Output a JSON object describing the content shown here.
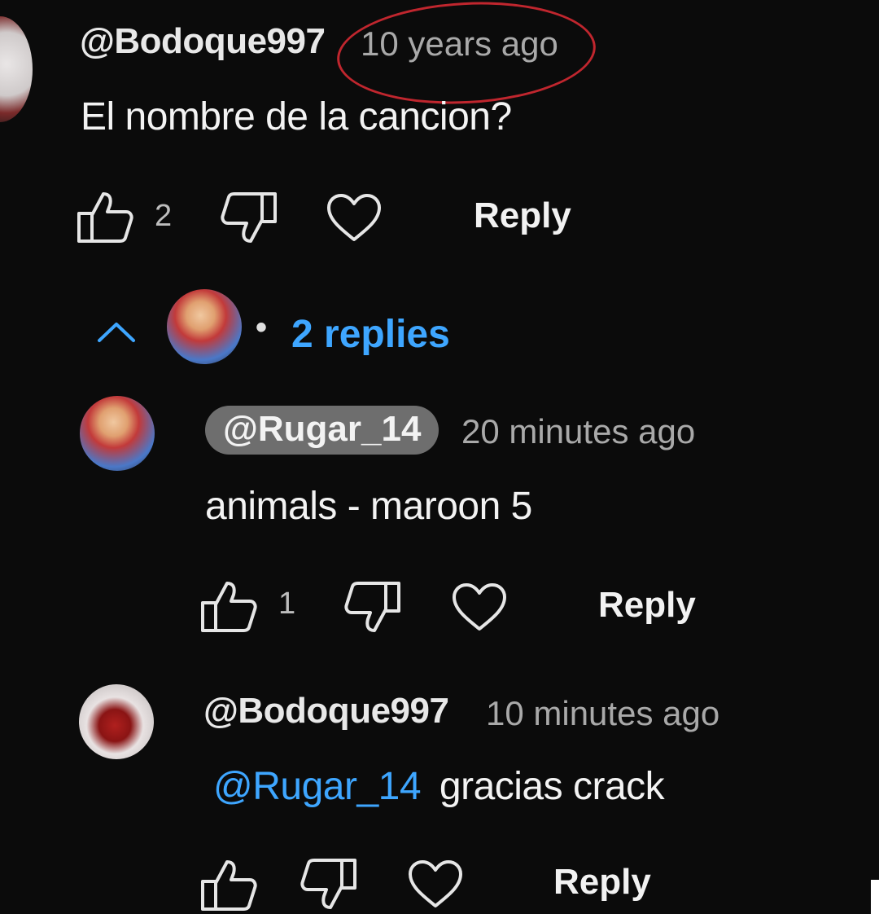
{
  "comment": {
    "author": "@Bodoque997",
    "time": "10 years ago",
    "text": "El nombre de la cancion?",
    "likes": "2",
    "reply_label": "Reply"
  },
  "replies_toggle": {
    "bullet": "•",
    "label": "2 replies"
  },
  "replies": [
    {
      "author": "@Rugar_14",
      "time": "20 minutes ago",
      "text": "animals - maroon 5",
      "likes": "1",
      "reply_label": "Reply"
    },
    {
      "author": "@Bodoque997",
      "time": "10 minutes ago",
      "mention": "@Rugar_14",
      "text": "gracias crack",
      "likes": "",
      "reply_label": "Reply"
    }
  ],
  "colors": {
    "background": "#0b0b0b",
    "link": "#3ea6ff",
    "highlight_circle": "#c0262e",
    "chip": "#6e6e6e"
  },
  "icons": {
    "like": "thumbs-up-icon",
    "dislike": "thumbs-down-icon",
    "heart": "heart-icon",
    "collapse": "chevron-up-icon"
  }
}
